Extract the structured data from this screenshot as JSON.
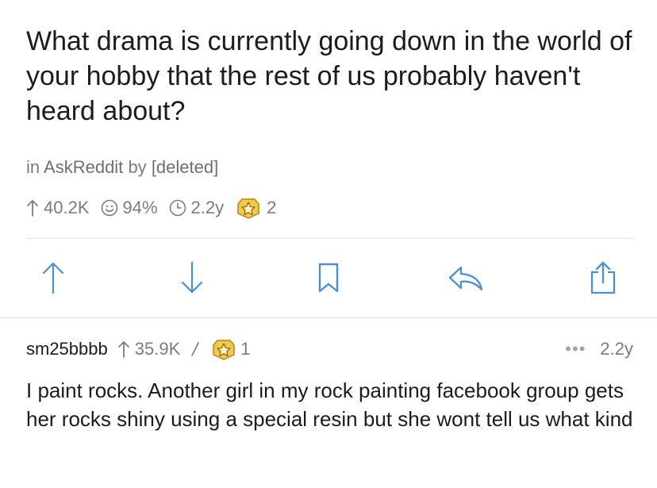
{
  "post": {
    "title": "What drama is currently going down in the world of your hobby that the rest of us probably haven't heard about?",
    "in_label": "in",
    "subreddit": "AskReddit",
    "by_label": "by",
    "author": "[deleted]",
    "score": "40.2K",
    "upvote_ratio": "94%",
    "age": "2.2y",
    "awards": "2"
  },
  "actions": {
    "upvote": "upvote-icon",
    "downvote": "downvote-icon",
    "save": "bookmark-icon",
    "reply": "reply-icon",
    "share": "share-icon"
  },
  "comment": {
    "author": "sm25bbbb",
    "score": "35.9K",
    "awards": "1",
    "age": "2.2y",
    "body": "I paint rocks.  Another girl in my rock painting facebook group gets her rocks shiny using a special resin but she wont tell us what kind"
  },
  "colors": {
    "accent_blue": "#4a90d9",
    "muted_text": "#7c7c80",
    "award_gold": "#d8a520"
  }
}
